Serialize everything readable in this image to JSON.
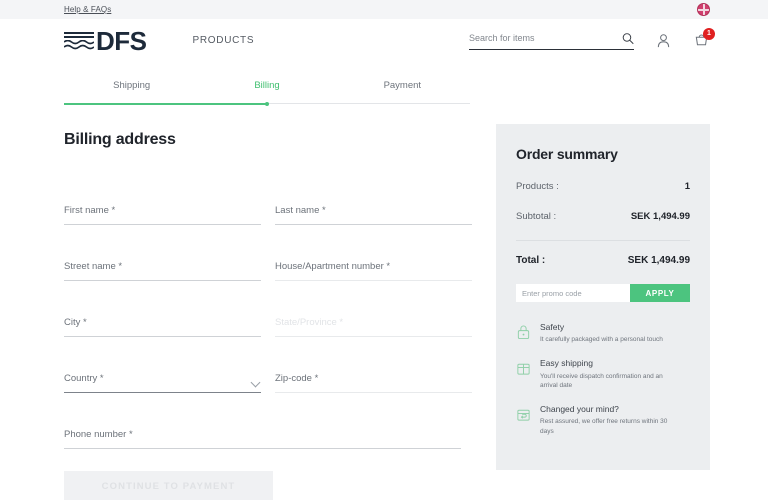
{
  "topbar": {
    "help_link": "Help & FAQs",
    "flag_icon": "uk-flag-icon"
  },
  "header": {
    "brand_text": "DFS",
    "nav_products": "PRODUCTS",
    "search_placeholder": "Search for items",
    "search_value": "",
    "search_icon": "search-icon",
    "account_icon": "user-icon",
    "cart_icon": "cart-icon",
    "cart_count": "1"
  },
  "stepper": {
    "steps": [
      {
        "label": "Shipping",
        "state": "complete"
      },
      {
        "label": "Billing",
        "state": "active"
      },
      {
        "label": "Payment",
        "state": "upcoming"
      }
    ],
    "progress_percent": 50,
    "accent_color": "#4cc47f"
  },
  "form": {
    "title": "Billing address",
    "fields": [
      {
        "label": "First name *",
        "value": "",
        "state": "normal",
        "width": "half"
      },
      {
        "label": "Last name *",
        "value": "",
        "state": "normal",
        "width": "half"
      },
      {
        "label": "Street name *",
        "value": "",
        "state": "normal",
        "width": "half"
      },
      {
        "label": "House/Apartment number *",
        "value": "",
        "state": "faint",
        "width": "half"
      },
      {
        "label": "City *",
        "value": "",
        "state": "normal",
        "width": "half"
      },
      {
        "label": "State/Province *",
        "value": "",
        "state": "disabled",
        "width": "half"
      },
      {
        "label": "Country *",
        "value": "",
        "state": "strong",
        "width": "half",
        "control": "select"
      },
      {
        "label": "Zip-code *",
        "value": "",
        "state": "faint",
        "width": "half"
      },
      {
        "label": "Phone number *",
        "value": "",
        "state": "normal",
        "width": "full"
      }
    ],
    "submit_label": "CONTINUE TO PAYMENT",
    "submit_disabled": true
  },
  "summary": {
    "title": "Order summary",
    "products_label": "Products :",
    "products_value": "1",
    "subtotal_label": "Subtotal :",
    "subtotal_value": "SEK 1,494.99",
    "total_label": "Total :",
    "total_value": "SEK 1,494.99",
    "promo_placeholder": "Enter promo code",
    "promo_value": "",
    "apply_label": "APPLY",
    "apply_color": "#4cc47f",
    "panel_color": "#eceef0"
  },
  "benefits": [
    {
      "icon": "lock-icon",
      "title": "Safety",
      "desc": "It carefully packaged with a personal touch"
    },
    {
      "icon": "package-icon",
      "title": "Easy shipping",
      "desc": "You'll receive dispatch confirmation and an arrival date"
    },
    {
      "icon": "return-box-icon",
      "title": "Changed your mind?",
      "desc": "Rest assured, we offer free returns within 30 days"
    }
  ]
}
